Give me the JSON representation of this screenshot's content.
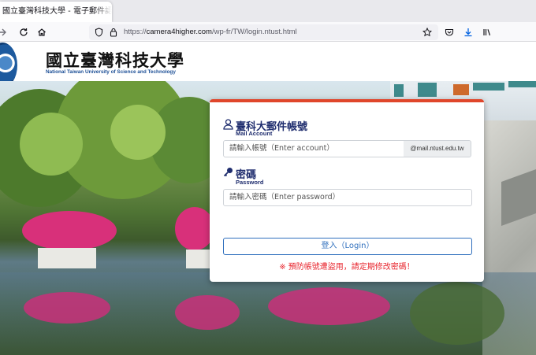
{
  "browser": {
    "tab_title": "國立臺灣科技大學 - 電子郵件認證",
    "url_scheme": "https://",
    "url_host": "camera4higher.com",
    "url_path": "/wp-fr/TW/login.ntust.html"
  },
  "header": {
    "school_name_zh": "國立臺灣科技大學",
    "school_name_en": "National Taiwan University of Science and Technology"
  },
  "login": {
    "account_title": "臺科大郵件帳號",
    "account_subtitle": "Mail Account",
    "account_placeholder": "請輸入帳號（Enter account）",
    "account_suffix": "@mail.ntust.edu.tw",
    "password_title": "密碼",
    "password_subtitle": "Password",
    "password_placeholder": "請輸入密碼（Enter password）",
    "login_button": "登入（Login）",
    "warning": "※ 預防帳號遭盜用，請定期修改密碼！"
  },
  "colors": {
    "accent_top": "#e0462b",
    "title_navy": "#1f2d6e",
    "button_blue": "#2f6fbd",
    "warning_red": "#e8272f"
  }
}
